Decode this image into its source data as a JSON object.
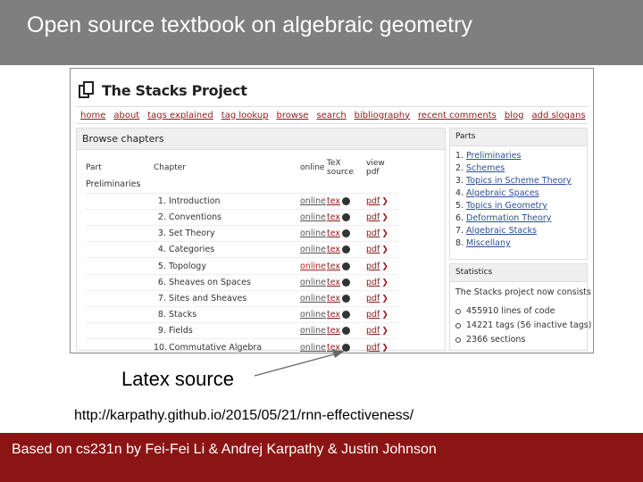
{
  "slide": {
    "title": "Open source textbook on algebraic geometry",
    "annotation": "Latex source",
    "url": "http://karpathy.github.io/2015/05/21/rnn-effectiveness/",
    "footer": "Based on cs231n by Fei-Fei Li & Andrej Karpathy & Justin Johnson",
    "colors": {
      "header_bg": "#7f7f7f",
      "footer_bg": "#8b1414",
      "link": "#8b1a1a"
    }
  },
  "site": {
    "title": "The Stacks Project",
    "logo_icon": "stacked-pages-icon",
    "nav": [
      "home",
      "about",
      "tags explained",
      "tag lookup",
      "browse",
      "search",
      "bibliography",
      "recent comments",
      "blog",
      "add slogans"
    ],
    "browse_heading": "Browse chapters",
    "columns": {
      "part": "Part",
      "chapter": "Chapter",
      "online": "online",
      "tex": "TeX source",
      "pdf": "view pdf"
    },
    "part_name": "Preliminaries",
    "chapters": [
      {
        "num": "1.",
        "name": "Introduction",
        "online": "online",
        "tex": "tex",
        "pdf": "pdf"
      },
      {
        "num": "2.",
        "name": "Conventions",
        "online": "online",
        "tex": "tex",
        "pdf": "pdf"
      },
      {
        "num": "3.",
        "name": "Set Theory",
        "online": "online",
        "tex": "tex",
        "pdf": "pdf"
      },
      {
        "num": "4.",
        "name": "Categories",
        "online": "online",
        "tex": "tex",
        "pdf": "pdf"
      },
      {
        "num": "5.",
        "name": "Topology",
        "online": "online",
        "tex": "tex",
        "pdf": "pdf"
      },
      {
        "num": "6.",
        "name": "Sheaves on Spaces",
        "online": "online",
        "tex": "tex",
        "pdf": "pdf"
      },
      {
        "num": "7.",
        "name": "Sites and Sheaves",
        "online": "online",
        "tex": "tex",
        "pdf": "pdf"
      },
      {
        "num": "8.",
        "name": "Stacks",
        "online": "online",
        "tex": "tex",
        "pdf": "pdf"
      },
      {
        "num": "9.",
        "name": "Fields",
        "online": "online",
        "tex": "tex",
        "pdf": "pdf"
      },
      {
        "num": "10.",
        "name": "Commutative Algebra",
        "online": "online",
        "tex": "tex",
        "pdf": "pdf"
      }
    ],
    "parts_heading": "Parts",
    "parts": [
      {
        "num": "1.",
        "name": "Preliminaries"
      },
      {
        "num": "2.",
        "name": "Schemes"
      },
      {
        "num": "3.",
        "name": "Topics in Scheme Theory"
      },
      {
        "num": "4.",
        "name": "Algebraic Spaces"
      },
      {
        "num": "5.",
        "name": "Topics in Geometry"
      },
      {
        "num": "6.",
        "name": "Deformation Theory"
      },
      {
        "num": "7.",
        "name": "Algebraic Stacks"
      },
      {
        "num": "8.",
        "name": "Miscellany"
      }
    ],
    "stats_heading": "Statistics",
    "stats_intro": "The Stacks project now consists of",
    "stats": [
      "455910 lines of code",
      "14221 tags (56 inactive tags)",
      "2366 sections"
    ]
  }
}
